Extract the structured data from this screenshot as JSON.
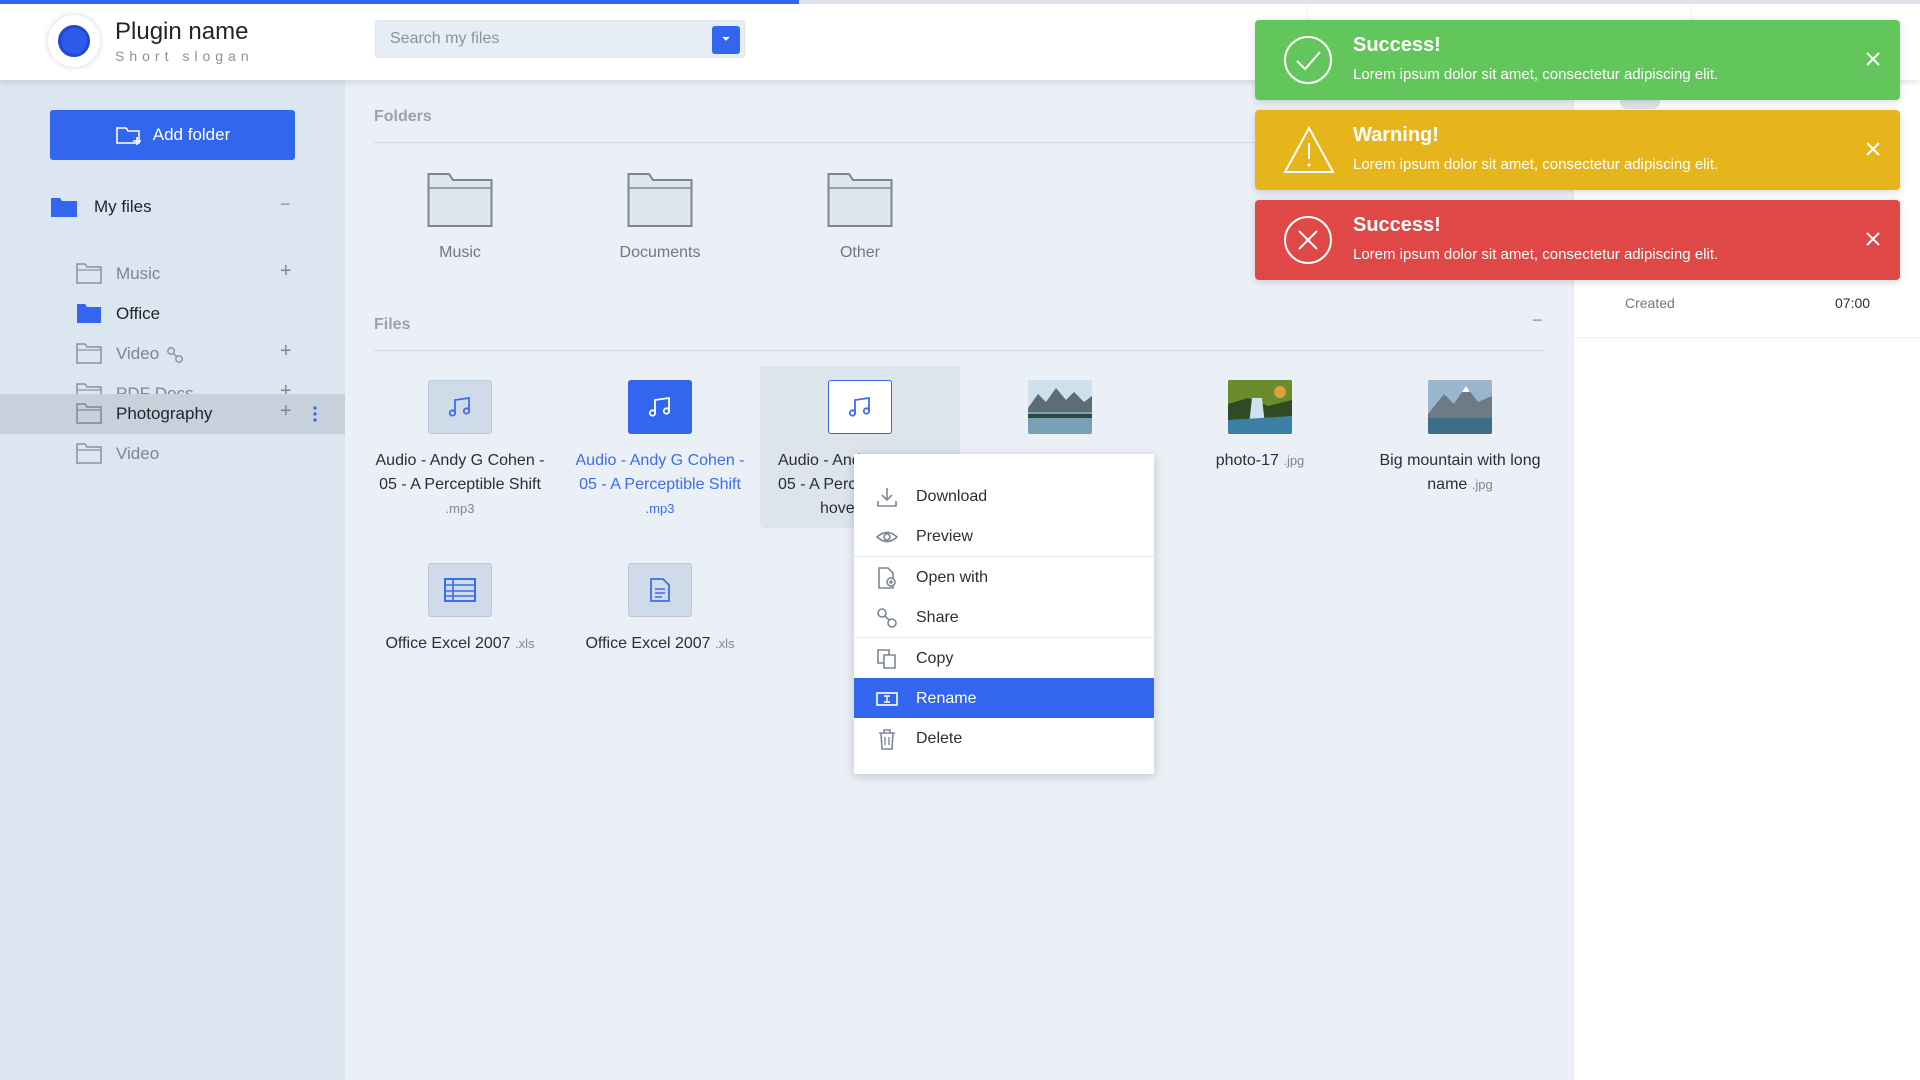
{
  "progress": {
    "fill_fraction": 0.416
  },
  "brand": {
    "name": "Plugin name",
    "slogan": "Short slogan",
    "accent": "#3366ee"
  },
  "search": {
    "placeholder": "Search my files",
    "value": ""
  },
  "sidebar": {
    "add_folder_label": "Add folder",
    "root": {
      "label": "My files",
      "toggle": "−"
    },
    "items": [
      {
        "label": "Music",
        "icon": "folder-outline-icon",
        "action": "+"
      },
      {
        "label": "Office",
        "icon": "folder-filled-icon",
        "action": ""
      },
      {
        "label": "Video",
        "icon": "folder-outline-icon",
        "action": "+",
        "shared": "link-icon"
      },
      {
        "label": "PDF Docs",
        "icon": "folder-outline-icon",
        "action": "+"
      },
      {
        "label": "Photography",
        "icon": "folder-outline-icon",
        "action": "+",
        "more": "kebab-icon"
      },
      {
        "label": "Video",
        "icon": "folder-outline-icon",
        "action": ""
      }
    ]
  },
  "main": {
    "folders_title": "Folders",
    "files_title": "Files",
    "files_toggle": "−",
    "folders": [
      {
        "label": "Music"
      },
      {
        "label": "Documents"
      },
      {
        "label": "Other"
      }
    ],
    "files": [
      {
        "name_line1": "Audio - Andy G Cohen -",
        "name_line2": "05 - A Perceptible Shift",
        "ext": ".mp3",
        "state": "normal",
        "icon": "music-note-icon"
      },
      {
        "name_line1": "Audio - Andy G Cohen -",
        "name_line2": "05 - A Perceptible Shift",
        "ext": ".mp3",
        "state": "selected",
        "icon": "music-note-icon"
      },
      {
        "name_line1": "Audio - And",
        "name_line2": "05 - A Perc",
        "name_line3": "hove",
        "state": "hovered",
        "icon": "music-note-icon"
      },
      {
        "name": "",
        "state": "photo"
      },
      {
        "name": "photo-17",
        "ext": ".jpg",
        "state": "photo"
      },
      {
        "name_line1": "Big mountain with long",
        "name_line2": "name",
        "ext": ".jpg",
        "state": "photo"
      },
      {
        "name": "Office Excel 2007",
        "ext": ".xls",
        "icon": "spreadsheet-icon"
      },
      {
        "name": "Office Excel 2007",
        "ext": ".xls",
        "icon": "document-icon"
      }
    ]
  },
  "details": {
    "created_label": "Created",
    "created_value": "07:00"
  },
  "context_menu": {
    "items": [
      {
        "label": "Download",
        "icon": "download-icon"
      },
      {
        "label": "Preview",
        "icon": "eye-icon"
      },
      {
        "label": "Open with",
        "icon": "open-with-icon"
      },
      {
        "label": "Share",
        "icon": "link-icon"
      },
      {
        "label": "Copy",
        "icon": "copy-icon"
      },
      {
        "label": "Rename",
        "icon": "rename-icon",
        "active": true
      },
      {
        "label": "Delete",
        "icon": "trash-icon"
      }
    ]
  },
  "toasts": [
    {
      "type": "success",
      "title": "Success!",
      "message": "Lorem ipsum dolor sit amet, consectetur adipiscing elit.",
      "color": "#62c65c"
    },
    {
      "type": "warning",
      "title": "Warning!",
      "message": "Lorem ipsum dolor sit amet, consectetur adipiscing elit.",
      "color": "#e6b51c"
    },
    {
      "type": "error",
      "title": "Success!",
      "message": "Lorem ipsum dolor sit amet, consectetur adipiscing elit.",
      "color": "#e04747"
    }
  ]
}
